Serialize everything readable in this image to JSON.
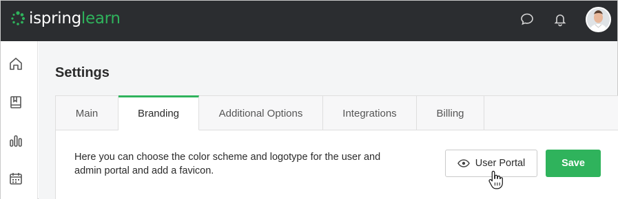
{
  "header": {
    "logo_prefix": "ispring",
    "logo_suffix": "learn",
    "icons": [
      "chat-icon",
      "bell-icon"
    ],
    "avatar": "user-avatar"
  },
  "sidebar": {
    "items": [
      {
        "icon": "home-icon"
      },
      {
        "icon": "book-icon"
      },
      {
        "icon": "reports-icon"
      },
      {
        "icon": "calendar-icon"
      }
    ]
  },
  "main": {
    "title": "Settings",
    "tabs": [
      {
        "label": "Main"
      },
      {
        "label": "Branding"
      },
      {
        "label": "Additional Options"
      },
      {
        "label": "Integrations"
      },
      {
        "label": "Billing"
      }
    ],
    "active_tab": "Branding",
    "description": "Here you can choose the color scheme and logotype for the user and admin portal and add a favicon.",
    "portal_button": "User Portal",
    "save_button": "Save"
  },
  "colors": {
    "accent": "#2fb35c",
    "topbar": "#2b2d30"
  }
}
